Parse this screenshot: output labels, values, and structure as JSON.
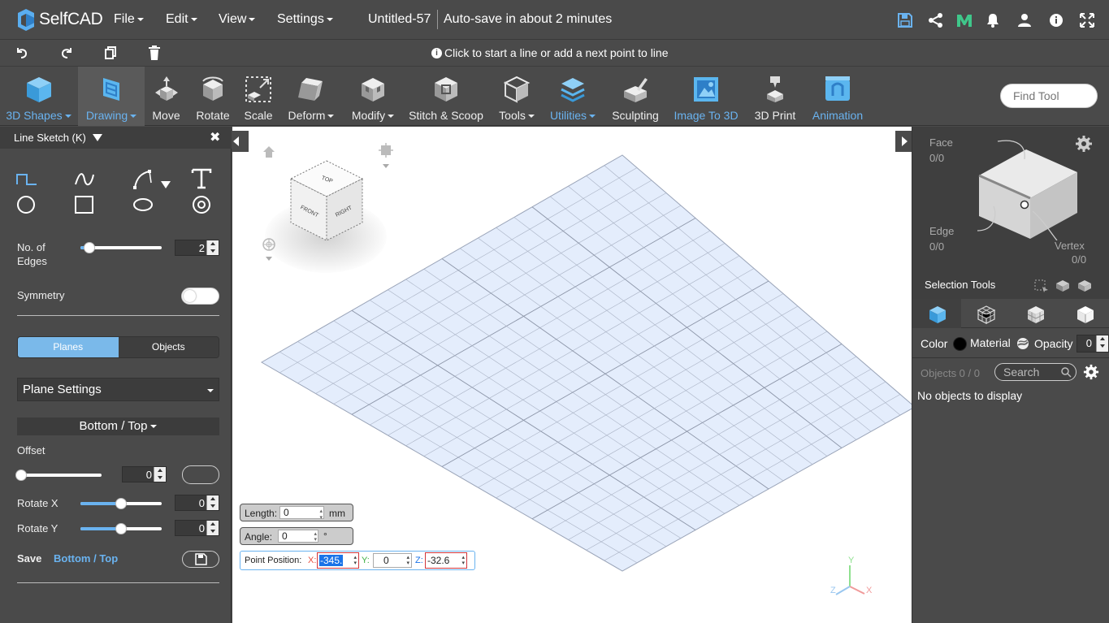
{
  "app": {
    "brand_self": "Self",
    "brand_cad": "CAD",
    "menus": [
      "File",
      "Edit",
      "View",
      "Settings"
    ],
    "doc_title": "Untitled-57",
    "autosave": "Auto-save in about 2 minutes"
  },
  "actionbar": {
    "hint": "Click to start a line or add a next point to line"
  },
  "ribbon": {
    "tools": [
      {
        "label": "3D Shapes",
        "dropdown": true,
        "blue": true
      },
      {
        "label": "Drawing",
        "dropdown": true,
        "blue": true
      },
      {
        "label": "Move"
      },
      {
        "label": "Rotate"
      },
      {
        "label": "Scale"
      },
      {
        "label": "Deform",
        "dropdown": true
      },
      {
        "label": "Modify",
        "dropdown": true
      },
      {
        "label": "Stitch & Scoop"
      },
      {
        "label": "Tools",
        "dropdown": true
      },
      {
        "label": "Utilities",
        "dropdown": true,
        "blue": true
      },
      {
        "label": "Sculpting"
      },
      {
        "label": "Image To 3D",
        "blue": true
      },
      {
        "label": "3D Print"
      },
      {
        "label": "Animation",
        "blue": true
      }
    ],
    "find_placeholder": "Find Tool"
  },
  "left_panel": {
    "title": "Line Sketch (K)",
    "edges_label_1": "No. of",
    "edges_label_2": "Edges",
    "edges_value": "2",
    "symmetry_label": "Symmetry",
    "seg_planes": "Planes",
    "seg_objects": "Objects",
    "plane_settings": "Plane Settings",
    "plane_view": "Bottom / Top",
    "offset_label": "Offset",
    "offset_value": "0",
    "rotate_x_label": "Rotate X",
    "rotate_x_value": "0",
    "rotate_y_label": "Rotate Y",
    "rotate_y_value": "0",
    "save_label": "Save",
    "save_target": "Bottom / Top"
  },
  "viewport": {
    "cube_faces": {
      "top": "TOP",
      "front": "FRONT",
      "right": "RIGHT"
    },
    "length_label": "Length:",
    "length_value": "0",
    "length_unit": "mm",
    "angle_label": "Angle:",
    "angle_value": "0",
    "angle_unit": "°",
    "point_label": "Point Position:",
    "x_label": "X:",
    "x_value": "-345.",
    "y_label": "Y:",
    "y_value": "0",
    "z_label": "Z:",
    "z_value": "-32.6",
    "axes": {
      "x": "X",
      "y": "Y",
      "z": "Z"
    }
  },
  "right_panel": {
    "face_label": "Face",
    "face_count": "0/0",
    "edge_label": "Edge",
    "edge_count": "0/0",
    "vertex_label": "Vertex",
    "vertex_count": "0/0",
    "selection_tools": "Selection Tools",
    "color_label": "Color",
    "material_label": "Material",
    "opacity_label": "Opacity",
    "opacity_value": "0",
    "objects_count": "Objects 0 / 0",
    "search_placeholder": "Search",
    "no_objects": "No objects to display"
  },
  "colors": {
    "accent": "#6ab3f0",
    "panel": "#4a4a4a",
    "grid_fill": "#e4edfc"
  }
}
